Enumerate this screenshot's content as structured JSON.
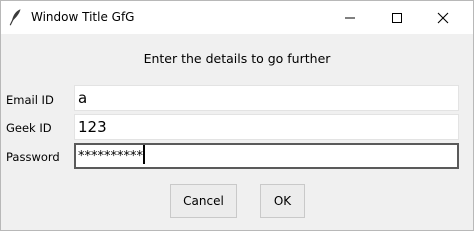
{
  "window": {
    "title": "Window Title GfG",
    "icon": "feather-icon",
    "controls": [
      "minimize-icon",
      "maximize-icon",
      "close-icon"
    ]
  },
  "form": {
    "prompt": "Enter the details to go further",
    "fields": [
      {
        "label": "Email ID",
        "value": "a"
      },
      {
        "label": "Geek ID",
        "value": "123"
      },
      {
        "label": "Password",
        "value": "**********",
        "focused": true
      }
    ]
  },
  "buttons": {
    "cancel_label": "Cancel",
    "ok_label": "OK"
  }
}
